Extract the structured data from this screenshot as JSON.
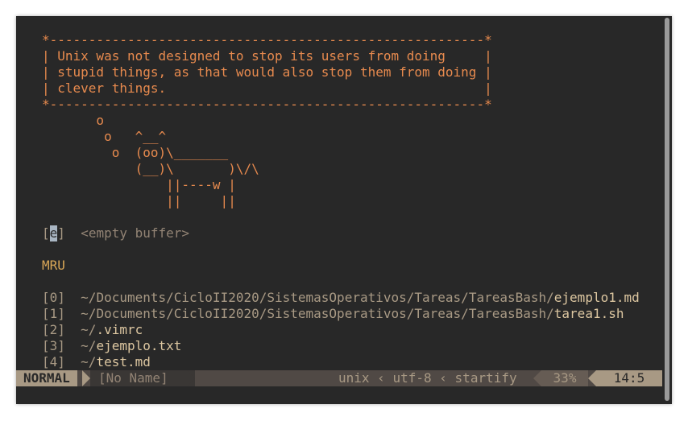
{
  "colors": {
    "background": "#282828",
    "quote": "#e78a4e",
    "mru_title": "#d8a657",
    "path": "#a89984",
    "file": "#ddc7a1"
  },
  "fortune": {
    "border_top": "*--------------------------------------------------------*",
    "lines": [
      "| Unix was not designed to stop its users from doing     |",
      "| stupid things, as that would also stop them from doing |",
      "| clever things.                                         |"
    ],
    "border_bottom": "*--------------------------------------------------------*"
  },
  "cowsay": [
    "       o",
    "        o   ^__^",
    "         o  (oo)\\_______",
    "            (__)\\       )\\/\\",
    "                ||----w |",
    "                ||     ||"
  ],
  "empty_buffer": {
    "key_open": "[",
    "key": "e",
    "key_close": "]",
    "label": "<empty buffer>"
  },
  "mru": {
    "title": "MRU",
    "items": [
      {
        "index": "[0]",
        "dir": "~/Documents/CicloII2020/SistemasOperativos/Tareas/TareasBash/",
        "file": "ejemplo1.md"
      },
      {
        "index": "[1]",
        "dir": "~/Documents/CicloII2020/SistemasOperativos/Tareas/TareasBash/",
        "file": "tarea1.sh"
      },
      {
        "index": "[2]",
        "dir": "~/",
        "file": ".vimrc"
      },
      {
        "index": "[3]",
        "dir": "~/",
        "file": "ejemplo.txt"
      },
      {
        "index": "[4]",
        "dir": "~/",
        "file": "test.md"
      }
    ]
  },
  "statusline": {
    "mode": "NORMAL",
    "filename": "[No Name]",
    "format": "unix",
    "sep1": "‹",
    "encoding": "utf-8",
    "sep2": "‹",
    "filetype": "startify",
    "percent": "33%",
    "position": "14:5"
  }
}
